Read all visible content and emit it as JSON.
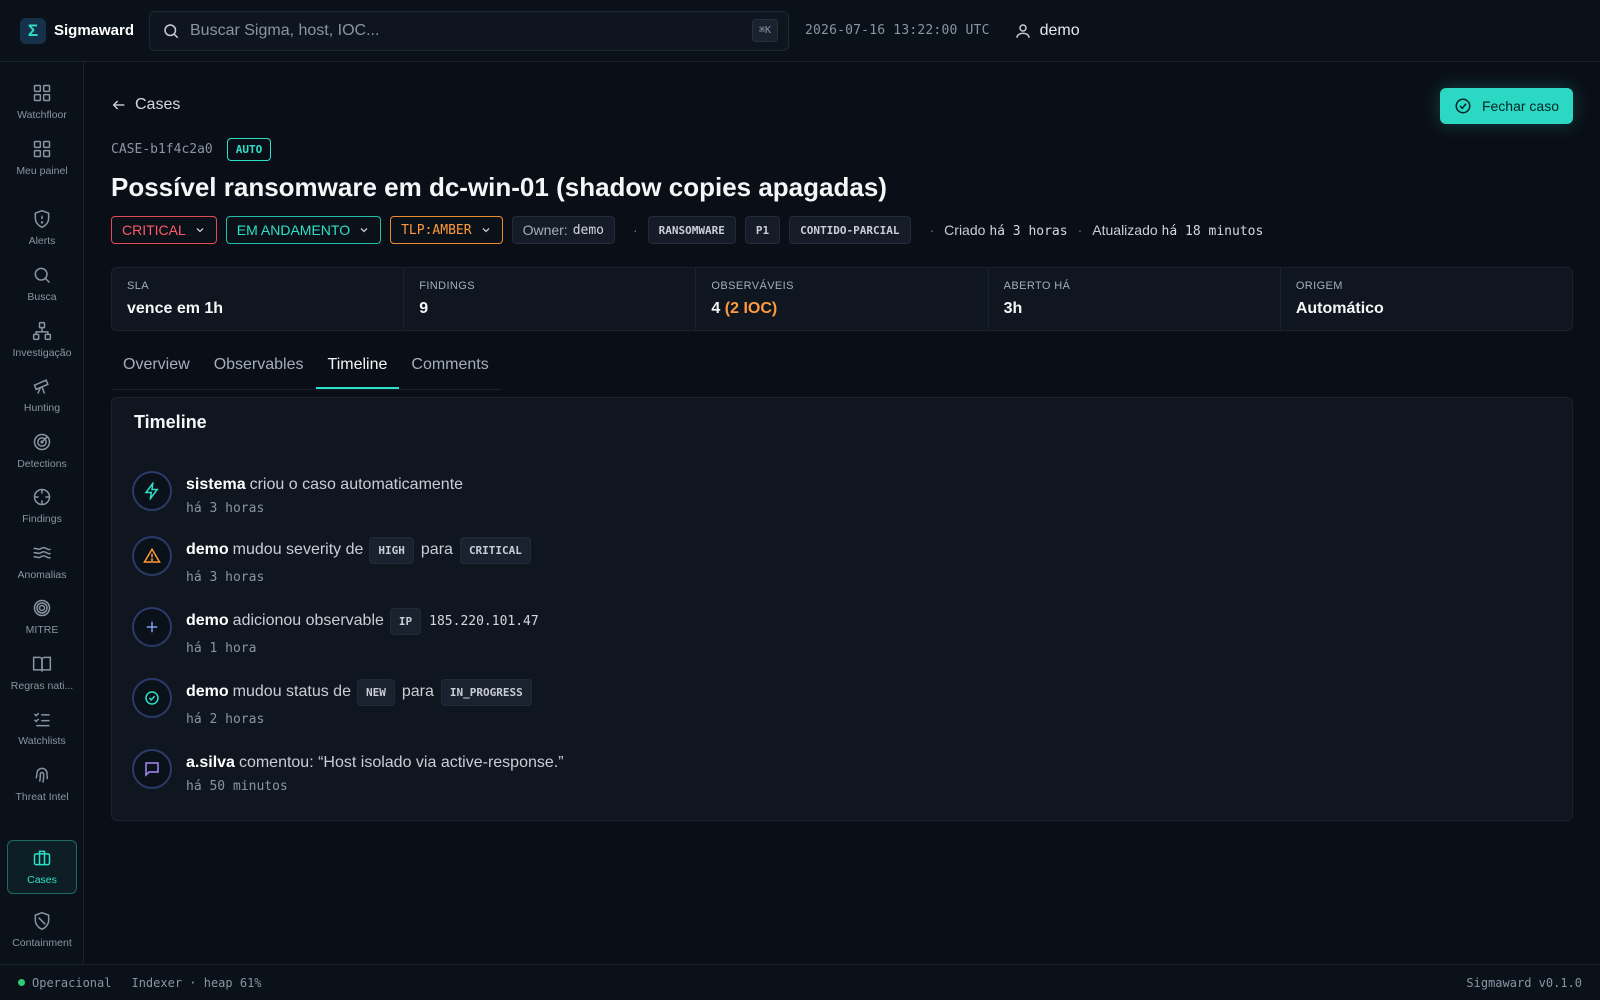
{
  "app": {
    "name": "Sigmaward",
    "logo_glyph": "Σ"
  },
  "search": {
    "placeholder": "Buscar Sigma, host, IOC...",
    "shortcut": "⌘K"
  },
  "clock": "2026-07-16 13:22:00 UTC",
  "user": {
    "name": "demo"
  },
  "sidebar": {
    "items": [
      {
        "label": "Watchfloor",
        "icon": "grid-icon"
      },
      {
        "label": "Meu painel",
        "icon": "grid-icon"
      },
      {
        "label": "Alerts",
        "icon": "shield-alert-icon"
      },
      {
        "label": "Busca",
        "icon": "search-icon"
      },
      {
        "label": "Investigação",
        "icon": "network-icon"
      },
      {
        "label": "Hunting",
        "icon": "telescope-icon"
      },
      {
        "label": "Detections",
        "icon": "radar-icon"
      },
      {
        "label": "Findings",
        "icon": "crosshair-icon"
      },
      {
        "label": "Anomalias",
        "icon": "waves-icon"
      },
      {
        "label": "MITRE",
        "icon": "target-icon"
      },
      {
        "label": "Regras nati...",
        "icon": "book-icon"
      },
      {
        "label": "Watchlists",
        "icon": "list-checks-icon"
      },
      {
        "label": "Threat Intel",
        "icon": "fingerprint-icon"
      },
      {
        "label": "Cases",
        "icon": "briefcase-icon",
        "active": true
      },
      {
        "label": "Containment",
        "icon": "shield-off-icon"
      }
    ]
  },
  "case": {
    "back_label": "Cases",
    "close_label": "Fechar caso",
    "id": "CASE-b1f4c2a0",
    "auto_badge": "AUTO",
    "title": "Possível ransomware em dc-win-01 (shadow copies apagadas)",
    "severity": "CRITICAL",
    "status": "EM ANDAMENTO",
    "tlp": "TLP:AMBER",
    "owner_label": "Owner:",
    "owner": "demo",
    "tags": [
      "RANSOMWARE",
      "P1",
      "CONTIDO-PARCIAL"
    ],
    "created_label": "Criado",
    "created": "há 3 horas",
    "updated_label": "Atualizado",
    "updated": "há 18 minutos"
  },
  "stats": [
    {
      "label": "SLA",
      "value": "vence em 1h"
    },
    {
      "label": "FINDINGS",
      "value": "9"
    },
    {
      "label": "OBSERVÁVEIS",
      "value": "4",
      "extra": "(2 IOC)"
    },
    {
      "label": "ABERTO HÁ",
      "value": "3h"
    },
    {
      "label": "ORIGEM",
      "value": "Automático"
    }
  ],
  "tabs": [
    {
      "label": "Overview"
    },
    {
      "label": "Observables"
    },
    {
      "label": "Timeline",
      "active": true
    },
    {
      "label": "Comments"
    }
  ],
  "timeline": {
    "title": "Timeline",
    "events": [
      {
        "icon": "bolt-icon",
        "actor": "sistema",
        "text": "criou o caso automaticamente",
        "time": "há 3 horas"
      },
      {
        "icon": "warning-icon",
        "actor": "demo",
        "text": "mudou severity de",
        "from": "HIGH",
        "to_word": "para",
        "to": "CRITICAL",
        "time": "há 3 horas"
      },
      {
        "icon": "plus-icon",
        "actor": "demo",
        "text": "adicionou observable",
        "chip": "IP",
        "value": "185.220.101.47",
        "time": "há 1 hora"
      },
      {
        "icon": "check-circle-icon",
        "actor": "demo",
        "text": "mudou status de",
        "from": "NEW",
        "to_word": "para",
        "to": "IN_PROGRESS",
        "time": "há 2 horas"
      },
      {
        "icon": "comment-icon",
        "actor": "a.silva",
        "text": "comentou: “Host isolado via active-response.”",
        "time": "há 50 minutos"
      }
    ]
  },
  "statusbar": {
    "status": "Operacional",
    "indexer": "Indexer · heap 61%",
    "version": "Sigmaward v0.1.0"
  },
  "colors": {
    "accent": "#2ee0c8",
    "critical": "#ff5a6a",
    "amber": "#ff9a3a",
    "background": "#0a0f17"
  }
}
